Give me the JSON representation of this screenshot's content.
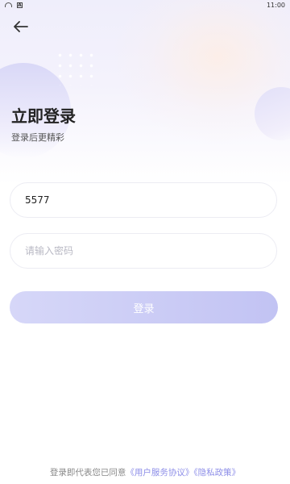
{
  "status_bar": {
    "time": "11:00",
    "icons": [
      "wifi-icon",
      "notification-a-icon"
    ]
  },
  "header": {
    "back_icon": "arrow-left-icon"
  },
  "page": {
    "title": "立即登录",
    "subtitle": "登录后更精彩"
  },
  "form": {
    "account": {
      "value": "5577",
      "placeholder": ""
    },
    "password": {
      "value": "",
      "placeholder": "请输入密码"
    },
    "login_button": "登录"
  },
  "agreement": {
    "prefix": "登录即代表您已同意",
    "user_agreement": "《用户服务协议》",
    "privacy_policy": "《隐私政策》"
  },
  "colors": {
    "accent": "#8d8ee8",
    "button_start": "#d6d7f8",
    "button_end": "#c2c3f3"
  }
}
